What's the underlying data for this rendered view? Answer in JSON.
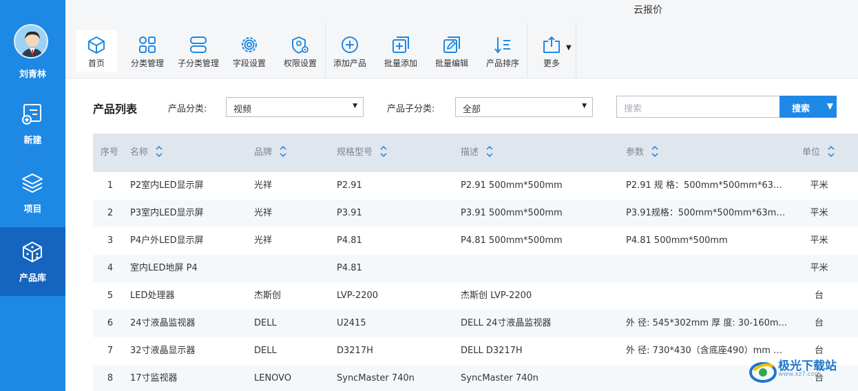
{
  "window": {
    "title": "云报价"
  },
  "user": {
    "name": "刘青林"
  },
  "sidebar": {
    "items": [
      {
        "label": "新建",
        "icon": "new-doc-icon"
      },
      {
        "label": "项目",
        "icon": "layers-icon"
      },
      {
        "label": "产品库",
        "icon": "box-icon",
        "active": true
      }
    ]
  },
  "toolbar": {
    "home": "首页",
    "category": "分类管理",
    "subcategory": "子分类管理",
    "fields": "字段设置",
    "permissions": "权限设置",
    "add_product": "添加产品",
    "batch_add": "批量添加",
    "batch_edit": "批量编辑",
    "sort": "产品排序",
    "more": "更多"
  },
  "filters": {
    "title": "产品列表",
    "category_label": "产品分类:",
    "category_value": "视频",
    "subcategory_label": "产品子分类:",
    "subcategory_value": "全部",
    "search_placeholder": "搜索",
    "search_button": "搜索"
  },
  "table": {
    "headers": {
      "no": "序号",
      "name": "名称",
      "brand": "品牌",
      "model": "规格型号",
      "desc": "描述",
      "param": "参数",
      "unit": "单位"
    },
    "rows": [
      {
        "no": "1",
        "name": "P2室内LED显示屏",
        "brand": "光祥",
        "model": "P2.91",
        "desc": "P2.91 500mm*500mm",
        "param": "P2.91 规 格：500mm*500mm*63m...",
        "unit": "平米"
      },
      {
        "no": "2",
        "name": "P3室内LED显示屏",
        "brand": "光祥",
        "model": "P3.91",
        "desc": "P3.91 500mm*500mm",
        "param": "P3.91规格：500mm*500mm*63mm...",
        "unit": "平米"
      },
      {
        "no": "3",
        "name": "P4户外LED显示屏",
        "brand": "光祥",
        "model": "P4.81",
        "desc": "P4.81 500mm*500mm",
        "param": "P4.81 500mm*500mm",
        "unit": "平米"
      },
      {
        "no": "4",
        "name": "室内LED地屏 P4",
        "brand": "",
        "model": "P4.81",
        "desc": "",
        "param": "",
        "unit": "平米"
      },
      {
        "no": "5",
        "name": "LED处理器",
        "brand": "杰斯创",
        "model": "LVP-2200",
        "desc": "杰斯创 LVP-2200",
        "param": "",
        "unit": "台"
      },
      {
        "no": "6",
        "name": "24寸液晶监视器",
        "brand": "DELL",
        "model": "U2415",
        "desc": "DELL 24寸液晶监视器",
        "param": "外 径: 545*302mm 厚 度: 30-160m...",
        "unit": "台"
      },
      {
        "no": "7",
        "name": "32寸液晶显示器",
        "brand": "DELL",
        "model": "D3217H",
        "desc": "DELL D3217H",
        "param": "外 径: 730*430（含底座490）mm 厚 ...",
        "unit": "台"
      },
      {
        "no": "8",
        "name": "17寸监视器",
        "brand": "LENOVO",
        "model": "SyncMaster 740n",
        "desc": "SyncMaster 740n",
        "param": "",
        "unit": "台"
      }
    ]
  },
  "watermark": {
    "text": "极光下载站",
    "sub": "www.xz7.com"
  },
  "colors": {
    "sidebar": "#1e88e5",
    "sidebar_active": "#1565c0",
    "accent": "#1e88e5",
    "header_bg": "#dfe6ee"
  }
}
